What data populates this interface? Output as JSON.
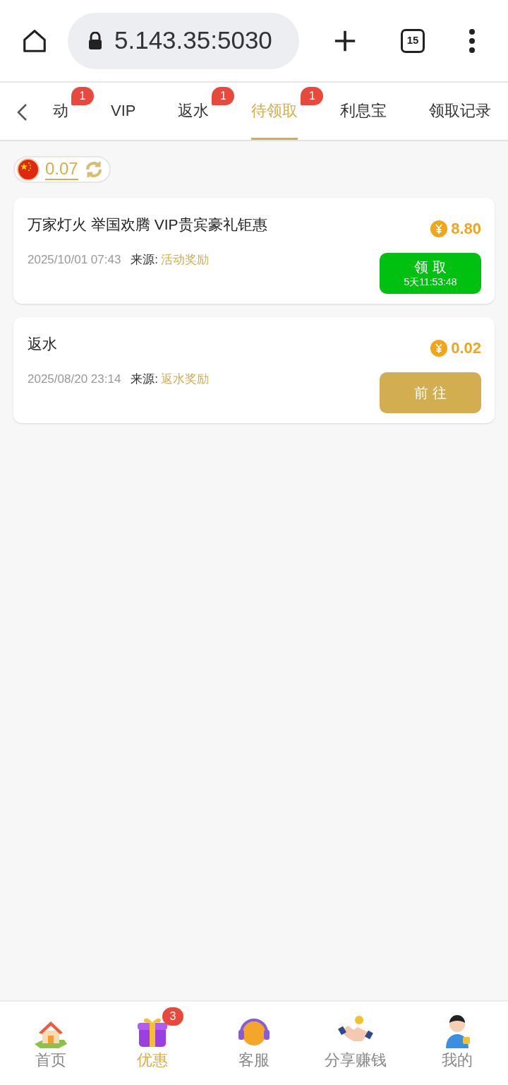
{
  "browser": {
    "url": "5.143.35:5030",
    "tab_count": "15"
  },
  "tabs": [
    {
      "label": "动",
      "badge": "1",
      "selected": false
    },
    {
      "label": "VIP",
      "selected": false
    },
    {
      "label": "返水",
      "badge": "1",
      "selected": false
    },
    {
      "label": "待领取",
      "badge": "1",
      "selected": true
    },
    {
      "label": "利息宝",
      "selected": false
    },
    {
      "label": "领取记录",
      "selected": false
    }
  ],
  "balance": "0.07",
  "rewards": [
    {
      "title": "万家灯火 举国欢腾 VIP贵宾豪礼钜惠",
      "amount": "8.80",
      "date": "2025/10/01 07:43",
      "source_label": "来源:",
      "source": "活动奖励",
      "button": {
        "kind": "claim",
        "label": "领 取",
        "countdown": "5天11:53:48"
      }
    },
    {
      "title": "返水",
      "amount": "0.02",
      "date": "2025/08/20 23:14",
      "source_label": "来源:",
      "source": "返水奖励",
      "button": {
        "kind": "goto",
        "label": "前 往"
      }
    }
  ],
  "nav": [
    {
      "kind": "home",
      "label": "首页",
      "selected": false
    },
    {
      "kind": "gift",
      "label": "优惠",
      "badge": "3",
      "selected": true
    },
    {
      "kind": "support",
      "label": "客服",
      "selected": false
    },
    {
      "kind": "share",
      "label": "分享赚钱",
      "selected": false
    },
    {
      "kind": "profile",
      "label": "我的",
      "selected": false
    }
  ]
}
